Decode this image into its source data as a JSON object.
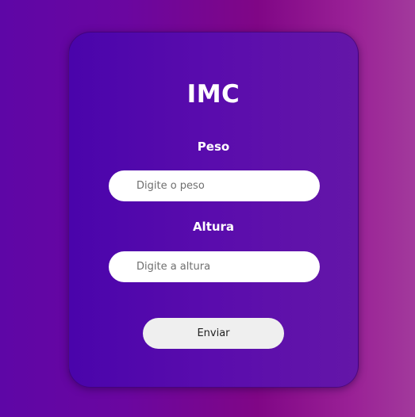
{
  "form": {
    "title": "IMC",
    "peso": {
      "label": "Peso",
      "placeholder": "Digite o peso",
      "value": ""
    },
    "altura": {
      "label": "Altura",
      "placeholder": "Digite a altura",
      "value": ""
    },
    "submit_label": "Enviar"
  },
  "colors": {
    "card": "#5207ac",
    "background_left": "#5e06a6",
    "background_right": "#a23a9c",
    "button": "#efefef"
  }
}
